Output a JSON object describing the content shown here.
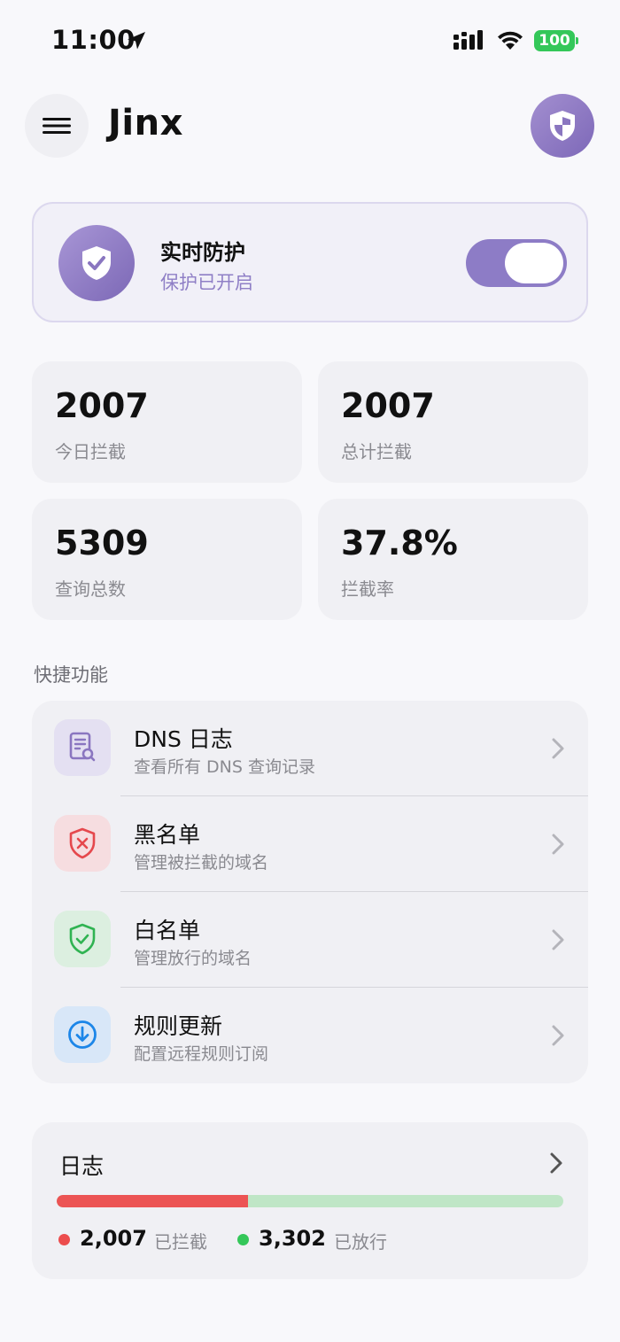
{
  "status_bar": {
    "time": "11:00",
    "battery": "100"
  },
  "header": {
    "title": "Jinx"
  },
  "protection": {
    "title": "实时防护",
    "subtitle": "保护已开启",
    "enabled": true
  },
  "stats": [
    {
      "value": "2007",
      "label": "今日拦截"
    },
    {
      "value": "2007",
      "label": "总计拦截"
    },
    {
      "value": "5309",
      "label": "查询总数"
    },
    {
      "value": "37.8%",
      "label": "拦截率"
    }
  ],
  "quick": {
    "section_label": "快捷功能",
    "items": [
      {
        "title": "DNS 日志",
        "subtitle": "查看所有 DNS 查询记录",
        "icon": "document-search-icon"
      },
      {
        "title": "黑名单",
        "subtitle": "管理被拦截的域名",
        "icon": "shield-x-icon"
      },
      {
        "title": "白名单",
        "subtitle": "管理放行的域名",
        "icon": "shield-check-icon"
      },
      {
        "title": "规则更新",
        "subtitle": "配置远程规则订阅",
        "icon": "download-circle-icon"
      }
    ]
  },
  "log": {
    "title": "日志",
    "blocked_count": "2,007",
    "blocked_label": "已拦截",
    "allowed_count": "3,302",
    "allowed_label": "已放行",
    "blocked_fraction": 0.378
  },
  "colors": {
    "accent": "#8d7cc6",
    "blocked": "#ec5454",
    "allowed": "#34c759",
    "allowed_bar": "#bfe6c6"
  }
}
